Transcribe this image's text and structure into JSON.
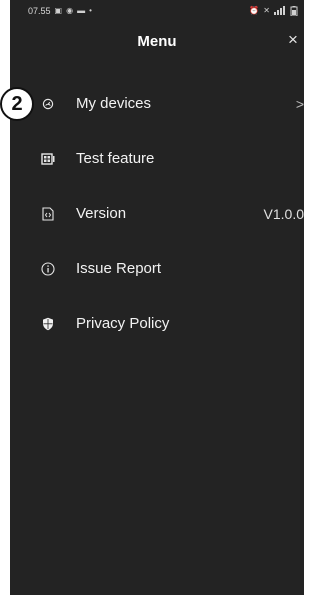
{
  "status_bar": {
    "time": "07.55",
    "left_icons": [
      "image-icon",
      "record-icon",
      "chat-icon",
      "dot-icon"
    ],
    "right_icons": [
      "alarm-icon",
      "mute-icon",
      "signal-icon",
      "battery-icon"
    ]
  },
  "header": {
    "title": "Menu",
    "close_label": "×"
  },
  "callout": {
    "number": "2"
  },
  "menu": {
    "items": [
      {
        "label": "My devices",
        "icon": "speedometer-icon",
        "trailing": ">"
      },
      {
        "label": "Test feature",
        "icon": "feature-grid-icon"
      },
      {
        "label": "Version",
        "icon": "code-file-icon",
        "value": "V1.0.0"
      },
      {
        "label": "Issue Report",
        "icon": "info-icon"
      },
      {
        "label": "Privacy Policy",
        "icon": "shield-icon"
      }
    ]
  }
}
